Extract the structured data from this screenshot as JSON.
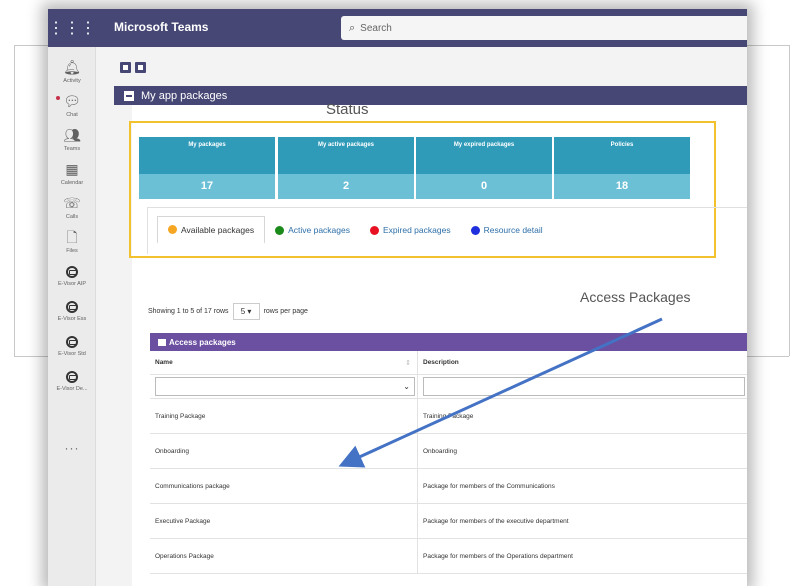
{
  "app": {
    "title": "Microsoft Teams",
    "search_placeholder": "Search",
    "waffle_icon": "waffle-icon",
    "search_icon": "search-icon"
  },
  "rail": {
    "items": [
      {
        "label": "Activity",
        "icon": "bell-icon"
      },
      {
        "label": "Chat",
        "icon": "chat-icon"
      },
      {
        "label": "Teams",
        "icon": "teams-icon"
      },
      {
        "label": "Calendar",
        "icon": "calendar-icon"
      },
      {
        "label": "Calls",
        "icon": "phone-icon"
      },
      {
        "label": "Files",
        "icon": "file-icon"
      },
      {
        "label": "E-Visor AIP",
        "icon": "evisor-icon"
      },
      {
        "label": "E-Visor Ess",
        "icon": "evisor-icon"
      },
      {
        "label": "E-Visor Std",
        "icon": "evisor-icon"
      },
      {
        "label": "E-Visor De...",
        "icon": "evisor-icon"
      }
    ],
    "more": "···"
  },
  "page": {
    "header_title": "My app packages"
  },
  "annotations": {
    "status": "Status",
    "access_packages": "Access Packages"
  },
  "cards": [
    {
      "label": "My packages",
      "value": "17"
    },
    {
      "label": "My active packages",
      "value": "2"
    },
    {
      "label": "My expired packages",
      "value": "0"
    },
    {
      "label": "Policies",
      "value": "18"
    }
  ],
  "tabs": [
    {
      "label": "Available packages",
      "color": "#f5a623",
      "active": true
    },
    {
      "label": "Active packages",
      "color": "#1a8a1a",
      "active": false
    },
    {
      "label": "Expired packages",
      "color": "#e81123",
      "active": false
    },
    {
      "label": "Resource detail",
      "color": "#1f2fdd",
      "active": false
    }
  ],
  "pagination": {
    "showing_text": "Showing 1 to 5 of 17 rows",
    "page_size": "5",
    "rows_per_page": "rows per page"
  },
  "table": {
    "title": "Access packages",
    "columns": [
      "Name",
      "Description"
    ],
    "rows": [
      {
        "name": "Training Package",
        "description": "Training Package"
      },
      {
        "name": "Onboarding",
        "description": "Onboarding"
      },
      {
        "name": "Communications package",
        "description": "Package for members of the Communications"
      },
      {
        "name": "Executive Package",
        "description": "Package for members of the executive department"
      },
      {
        "name": "Operations Package",
        "description": "Package for members of the Operations department"
      }
    ]
  },
  "colors": {
    "teams_purple": "#464775",
    "card_top": "#2f9bb9",
    "card_bottom": "#6cc0d6",
    "table_header": "#6b4fa1",
    "status_box": "#f2c12e",
    "arrow": "#4472c4"
  }
}
